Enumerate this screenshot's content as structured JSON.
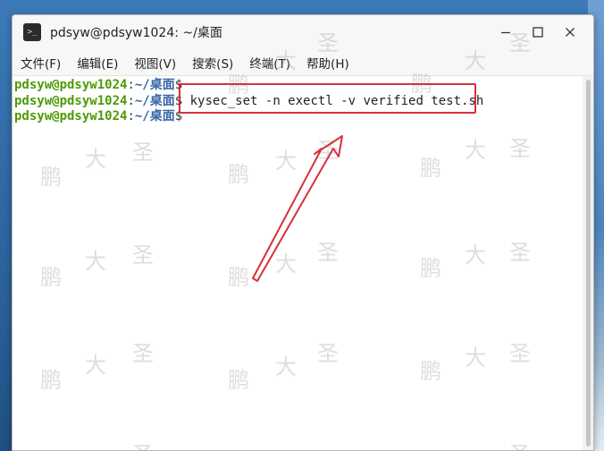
{
  "window": {
    "title": "pdsyw@pdsyw1024: ~/桌面",
    "app_icon_glyph": ">_"
  },
  "menu": {
    "items": [
      "文件(F)",
      "编辑(E)",
      "视图(V)",
      "搜索(S)",
      "终端(T)",
      "帮助(H)"
    ]
  },
  "terminal": {
    "prompt_user": "pdsyw@pdsyw1024",
    "prompt_colon": ":",
    "prompt_path": "~/桌面",
    "prompt_dollar": "$",
    "lines": [
      {
        "command": ""
      },
      {
        "command": " kysec_set -n exectl -v verified test.sh"
      },
      {
        "command": ""
      }
    ]
  },
  "watermark": {
    "chars": [
      "鹏",
      "大",
      "圣"
    ]
  },
  "colors": {
    "prompt_user": "#4e9a06",
    "prompt_path": "#3465a4",
    "annotation": "#d6323a"
  },
  "icons": {
    "minimize": "minimize-icon",
    "maximize": "maximize-icon",
    "close": "close-icon",
    "app": "terminal-app-icon"
  }
}
